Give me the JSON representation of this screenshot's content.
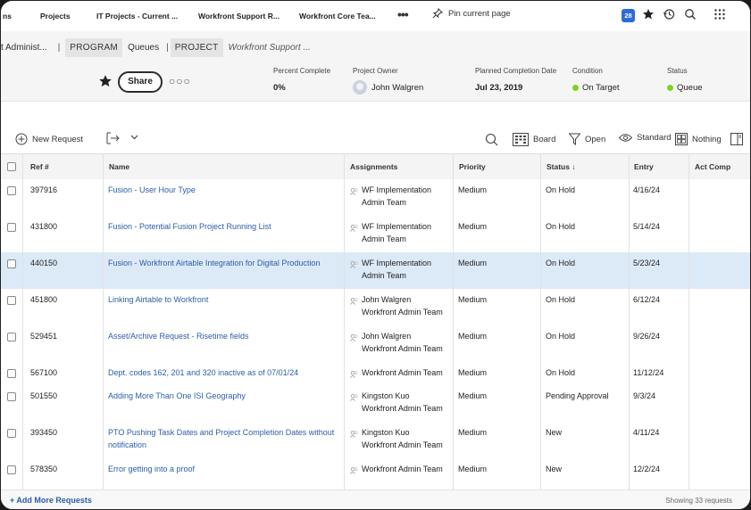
{
  "nav": {
    "tabs": [
      "ns",
      "Projects",
      "IT Projects - Current ...",
      "Workfront Support R...",
      "Workfront Core Tea..."
    ],
    "more": "•••",
    "pin_label": "Pin current page",
    "badge": "28"
  },
  "header": {
    "crumbs": {
      "admin": "t Administ...",
      "sep": "|",
      "program": "PROGRAM",
      "queues": "Queues",
      "sep2": "|",
      "project": "PROJECT",
      "project_name": "Workfront Support ..."
    },
    "share_label": "Share",
    "more": "○○○",
    "fields": {
      "percent_label": "Percent Complete",
      "percent_value": "0%",
      "owner_label": "Project Owner",
      "owner_value": "John Walgren",
      "planned_label": "Planned Completion Date",
      "planned_value": "Jul 23, 2019",
      "condition_label": "Condition",
      "condition_value": "On Target",
      "status_label": "Status",
      "status_value": "Queue"
    },
    "status_color": "#7ed321"
  },
  "toolbar": {
    "new_request": "New Request",
    "board": "Board",
    "open": "Open",
    "standard": "Standard",
    "nothing": "Nothing"
  },
  "table": {
    "columns": [
      "Ref #",
      "Name",
      "Assignments",
      "Priority",
      "Status ↓",
      "Entry",
      "Act Comp"
    ],
    "rows": [
      {
        "ref": "397916",
        "name": [
          "Fusion - User Hour Type",
          ""
        ],
        "asg": [
          "WF Implementation",
          "Admin Team"
        ],
        "priority": "Medium",
        "status": "On Hold",
        "entry": "4/16/24"
      },
      {
        "ref": "431800",
        "name": [
          "Fusion - Potential Fusion Project Running List",
          ""
        ],
        "asg": [
          "WF Implementation",
          "Admin Team"
        ],
        "priority": "Medium",
        "status": "On Hold",
        "entry": "5/14/24"
      },
      {
        "ref": "440150",
        "name": [
          "Fusion - Workfront Airtable Integration for Digital Production",
          ""
        ],
        "asg": [
          "WF Implementation",
          "Admin Team"
        ],
        "priority": "Medium",
        "status": "On Hold",
        "entry": "5/23/24"
      },
      {
        "ref": "451800",
        "name": [
          "Linking Airtable to Workfront",
          ""
        ],
        "asg": [
          "John Walgren",
          "Workfront Admin Team"
        ],
        "priority": "Medium",
        "status": "On Hold",
        "entry": "6/12/24"
      },
      {
        "ref": "529451",
        "name": [
          "Asset/Archive Request - Risetime fields",
          ""
        ],
        "asg": [
          "John Walgren",
          "Workfront Admin Team"
        ],
        "priority": "Medium",
        "status": "On Hold",
        "entry": "9/26/24"
      },
      {
        "ref": "567100",
        "name": [
          "Dept. codes 162, 201 and 320 inactive as of 07/01/24",
          ""
        ],
        "asg": [
          "Workfront Admin Team",
          ""
        ],
        "priority": "Medium",
        "status": "On Hold",
        "entry": "11/12/24"
      },
      {
        "ref": "501550",
        "name": [
          "Adding More Than One ISI Geography",
          ""
        ],
        "asg": [
          "Kingston Kuo",
          "Workfront Admin Team"
        ],
        "priority": "Medium",
        "status": "Pending Approval",
        "entry": "9/3/24"
      },
      {
        "ref": "393450",
        "name": [
          "PTO Pushing Task Dates and Project Completion Dates without",
          "notification"
        ],
        "asg": [
          "Kingston Kuo",
          "Workfront Admin Team"
        ],
        "priority": "Medium",
        "status": "New",
        "entry": "4/11/24"
      },
      {
        "ref": "578350",
        "name": [
          "Error getting into a proof",
          ""
        ],
        "asg": [
          "Workfront Admin Team",
          ""
        ],
        "priority": "Medium",
        "status": "New",
        "entry": "12/2/24"
      }
    ]
  },
  "footer": {
    "add_more": "+ Add More Requests",
    "count": "Showing 33 requests"
  }
}
